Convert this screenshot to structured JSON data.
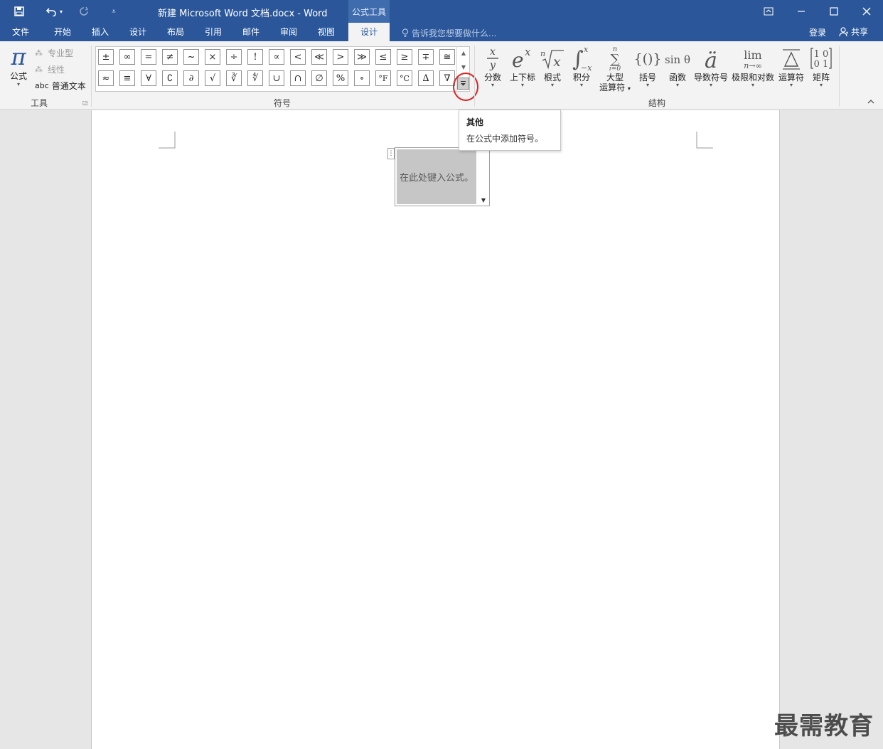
{
  "titlebar": {
    "title": "新建 Microsoft Word 文档.docx - Word",
    "context_tab": "公式工具",
    "qat": {
      "save_icon": "save-icon",
      "undo_icon": "undo-icon",
      "redo_icon": "redo-icon",
      "customize_icon": "customize-qat-icon"
    },
    "window_buttons": [
      "ribbon-display-icon",
      "minimize-icon",
      "maximize-icon",
      "close-icon"
    ]
  },
  "tabs": [
    {
      "label": "文件",
      "active": false
    },
    {
      "label": "开始",
      "active": false
    },
    {
      "label": "插入",
      "active": false
    },
    {
      "label": "设计",
      "active": false
    },
    {
      "label": "布局",
      "active": false
    },
    {
      "label": "引用",
      "active": false
    },
    {
      "label": "邮件",
      "active": false
    },
    {
      "label": "审阅",
      "active": false
    },
    {
      "label": "视图",
      "active": false
    },
    {
      "label": "设计",
      "active": true
    }
  ],
  "tell_me": {
    "placeholder": "告诉我您想要做什么..."
  },
  "account": {
    "login": "登录",
    "share": "共享"
  },
  "tools": {
    "equation_label": "公式",
    "professional": "专业型",
    "linear": "线性",
    "normal_text": "普通文本",
    "normal_text_prefix": "abc",
    "group_label": "工具"
  },
  "symbols": {
    "group_label": "符号",
    "row1": [
      "±",
      "∞",
      "=",
      "≠",
      "~",
      "×",
      "÷",
      "!",
      "∝",
      "<",
      "≪",
      ">",
      "≫",
      "≤",
      "≥",
      "∓",
      "≅"
    ],
    "row2": [
      "≈",
      "≡",
      "∀",
      "∁",
      "∂",
      "√",
      "∛",
      "∜",
      "∪",
      "∩",
      "∅",
      "%",
      "∘",
      "°F",
      "°C",
      "∆",
      "∇"
    ]
  },
  "structures": {
    "group_label": "结构",
    "items": [
      {
        "icon": "fraction-icon",
        "label": "分数",
        "label2": ""
      },
      {
        "icon": "script-icon",
        "label": "上下标",
        "label2": ""
      },
      {
        "icon": "radical-icon",
        "label": "根式",
        "label2": ""
      },
      {
        "icon": "integral-icon",
        "label": "积分",
        "label2": ""
      },
      {
        "icon": "large-operator-icon",
        "label": "大型",
        "label2": "运算符"
      },
      {
        "icon": "bracket-icon",
        "label": "括号",
        "label2": ""
      },
      {
        "icon": "function-icon",
        "label": "函数",
        "label2": ""
      },
      {
        "icon": "accent-icon",
        "label": "导数符号",
        "label2": ""
      },
      {
        "icon": "limit-log-icon",
        "label": "极限和对数",
        "label2": ""
      },
      {
        "icon": "operator-icon",
        "label": "运算符",
        "label2": ""
      },
      {
        "icon": "matrix-icon",
        "label": "矩阵",
        "label2": ""
      }
    ]
  },
  "document": {
    "equation_placeholder": "在此处键入公式。"
  },
  "tooltip": {
    "title": "其他",
    "description": "在公式中添加符号。"
  },
  "watermark": "最需教育",
  "colors": {
    "brand": "#2b579a",
    "highlight_circle": "#e02020"
  }
}
